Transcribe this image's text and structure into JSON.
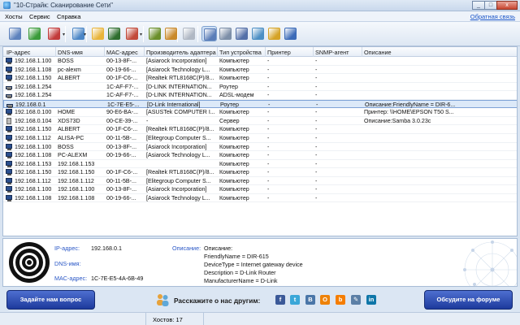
{
  "window": {
    "title": "\"10-Страйк: Сканирование Сети\"",
    "controls": [
      "_",
      "□",
      "x"
    ]
  },
  "menu": {
    "items": [
      "Хосты",
      "Сервис",
      "Справка"
    ],
    "feedback_link": "Обратная связь"
  },
  "toolbar": {
    "buttons": [
      {
        "name": "scan-network-icon",
        "color": "#5d82bd"
      },
      {
        "name": "add-host-icon",
        "color": "#3a9b3a"
      },
      {
        "name": "delete-host-icon",
        "color": "#c23b3b"
      },
      {
        "name": "network-icon",
        "color": "#4b86c6"
      },
      {
        "name": "open-folder-icon",
        "color": "#e8b43a"
      },
      {
        "name": "terminal-icon",
        "color": "#2e6e2e"
      },
      {
        "name": "tools-icon",
        "color": "#c24a3a"
      },
      {
        "name": "battery-icon",
        "color": "#6b8f2a"
      },
      {
        "name": "cable-icon",
        "color": "#c9892a"
      },
      {
        "name": "settings-gear-icon",
        "color": "#b0b8c4"
      },
      {
        "name": "details-view-icon",
        "color": "#5a7db8"
      },
      {
        "name": "document-icon",
        "color": "#7d8fa8"
      },
      {
        "name": "monitor-icon",
        "color": "#5470a8"
      },
      {
        "name": "chart-icon",
        "color": "#4c8fc4"
      },
      {
        "name": "shield-icon",
        "color": "#d5a326"
      },
      {
        "name": "network-map-icon",
        "color": "#3c6bb8"
      }
    ]
  },
  "table": {
    "columns": [
      "IP-адрес",
      "DNS-имя",
      "MAC-адрес",
      "Производитель адаптера",
      "Тип устройства",
      "Принтер",
      "SNMP-агент",
      "Описание"
    ],
    "rows": [
      {
        "icon": "pc",
        "ip": "192.168.1.100",
        "dns": "BOSS",
        "mac": "00-13-8F-...",
        "vendor": "[Asiarock Incorporation]",
        "type": "Компьютер",
        "printer": "-",
        "snmp": "-",
        "desc": ""
      },
      {
        "icon": "pc",
        "ip": "192.168.1.108",
        "dns": "pc-alexm",
        "mac": "00-19-66-...",
        "vendor": "[Asiarock Technology L...",
        "type": "Компьютер",
        "printer": "-",
        "snmp": "-",
        "desc": ""
      },
      {
        "icon": "pc",
        "ip": "192.168.1.150",
        "dns": "ALBERT",
        "mac": "00-1F-C6-...",
        "vendor": "[Realtek RTL8168C(P)/8...",
        "type": "Компьютер",
        "printer": "-",
        "snmp": "-",
        "desc": ""
      },
      {
        "icon": "router",
        "ip": "192.168.1.254",
        "dns": "",
        "mac": "1C-AF-F7-...",
        "vendor": "[D-LINK INTERNATION...",
        "type": "Роутер",
        "printer": "-",
        "snmp": "-",
        "desc": ""
      },
      {
        "icon": "router",
        "ip": "192.168.1.254",
        "dns": "",
        "mac": "1C-AF-F7-...",
        "vendor": "[D-LINK INTERNATION...",
        "type": "ADSL-модем",
        "printer": "-",
        "snmp": "-",
        "desc": ""
      },
      {
        "icon": "router",
        "ip": "192.168.0.1",
        "dns": "",
        "mac": "1C-7E-E5-...",
        "vendor": "[D-Link International]",
        "type": "Роутер",
        "printer": "-",
        "snmp": "-",
        "desc": "Описание:FriendlyName = DIR-6...",
        "selected": true
      },
      {
        "icon": "pc",
        "ip": "192.168.0.100",
        "dns": "HOME",
        "mac": "90-E6-BA-...",
        "vendor": "[ASUSTek COMPUTER I...",
        "type": "Компьютер",
        "printer": "-",
        "snmp": "-",
        "desc": "Принтер: \\\\HOME\\EPSON T50 S..."
      },
      {
        "icon": "server",
        "ip": "192.168.0.104",
        "dns": "XDS73D",
        "mac": "00-CE-39-...",
        "vendor": "-",
        "type": "Сервер",
        "printer": "-",
        "snmp": "-",
        "desc": "Описание:Samba 3.0.23c"
      },
      {
        "icon": "pc",
        "ip": "192.168.1.150",
        "dns": "ALBERT",
        "mac": "00-1F-C6-...",
        "vendor": "[Realtek RTL8168C(P)/8...",
        "type": "Компьютер",
        "printer": "-",
        "snmp": "-",
        "desc": ""
      },
      {
        "icon": "pc",
        "ip": "192.168.1.112",
        "dns": "ALISA-PC",
        "mac": "00-11-5B-...",
        "vendor": "[Elitegroup Computer S...",
        "type": "Компьютер",
        "printer": "-",
        "snmp": "-",
        "desc": ""
      },
      {
        "icon": "pc",
        "ip": "192.168.1.100",
        "dns": "BOSS",
        "mac": "00-13-8F-...",
        "vendor": "[Asiarock Incorporation]",
        "type": "Компьютер",
        "printer": "-",
        "snmp": "-",
        "desc": ""
      },
      {
        "icon": "pc",
        "ip": "192.168.1.108",
        "dns": "PC-ALEXM",
        "mac": "00-19-66-...",
        "vendor": "[Asiarock Technology L...",
        "type": "Компьютер",
        "printer": "-",
        "snmp": "-",
        "desc": ""
      },
      {
        "icon": "pc",
        "ip": "192.168.1.153",
        "dns": "192.168.1.153",
        "mac": "",
        "vendor": "",
        "type": "Компьютер",
        "printer": "-",
        "snmp": "-",
        "desc": ""
      },
      {
        "icon": "pc",
        "ip": "192.168.1.150",
        "dns": "192.168.1.150",
        "mac": "00-1F-C6-...",
        "vendor": "[Realtek RTL8168C(P)/8...",
        "type": "Компьютер",
        "printer": "-",
        "snmp": "-",
        "desc": ""
      },
      {
        "icon": "pc",
        "ip": "192.168.1.112",
        "dns": "192.168.1.112",
        "mac": "00-11-5B-...",
        "vendor": "[Elitegroup Computer S...",
        "type": "Компьютер",
        "printer": "-",
        "snmp": "-",
        "desc": ""
      },
      {
        "icon": "pc",
        "ip": "192.168.1.100",
        "dns": "192.168.1.100",
        "mac": "00-13-8F-...",
        "vendor": "[Asiarock Incorporation]",
        "type": "Компьютер",
        "printer": "-",
        "snmp": "-",
        "desc": ""
      },
      {
        "icon": "pc",
        "ip": "192.168.1.108",
        "dns": "192.168.1.108",
        "mac": "00-19-66-...",
        "vendor": "[Asiarock Technology L...",
        "type": "Компьютер",
        "printer": "-",
        "snmp": "-",
        "desc": ""
      }
    ]
  },
  "details": {
    "ip_label": "IP-адрес:",
    "ip_value": "192.168.0.1",
    "dns_label": "DNS-имя:",
    "dns_value": "",
    "mac_label": "MAC-адрес:",
    "mac_value": "1C-7E-E5-4A-6B-49",
    "desc_label": "Описание:",
    "desc_lines": [
      "Описание:",
      "FriendlyName = DIR-615",
      "DeviceType = Internet gateway device",
      "Description = D-Link Router",
      "ManufacturerName = D-Link"
    ]
  },
  "bottom": {
    "ask_button": "Задайте нам вопрос",
    "share_text": "Расскажите о нас другим:",
    "forum_button": "Обсудите на форуме",
    "social": [
      {
        "name": "facebook-icon",
        "glyph": "f",
        "color": "#3b5998"
      },
      {
        "name": "twitter-icon",
        "glyph": "t",
        "color": "#3aa7d8"
      },
      {
        "name": "vkontakte-icon",
        "glyph": "В",
        "color": "#4a76a8"
      },
      {
        "name": "odnoklassniki-icon",
        "glyph": "О",
        "color": "#ee8208"
      },
      {
        "name": "blogger-icon",
        "glyph": "b",
        "color": "#f57d00"
      },
      {
        "name": "livejournal-icon",
        "glyph": "✎",
        "color": "#5b7fa6"
      },
      {
        "name": "linkedin-icon",
        "glyph": "in",
        "color": "#0e76a8"
      }
    ]
  },
  "status": {
    "hosts_count": "Хостов: 17"
  }
}
